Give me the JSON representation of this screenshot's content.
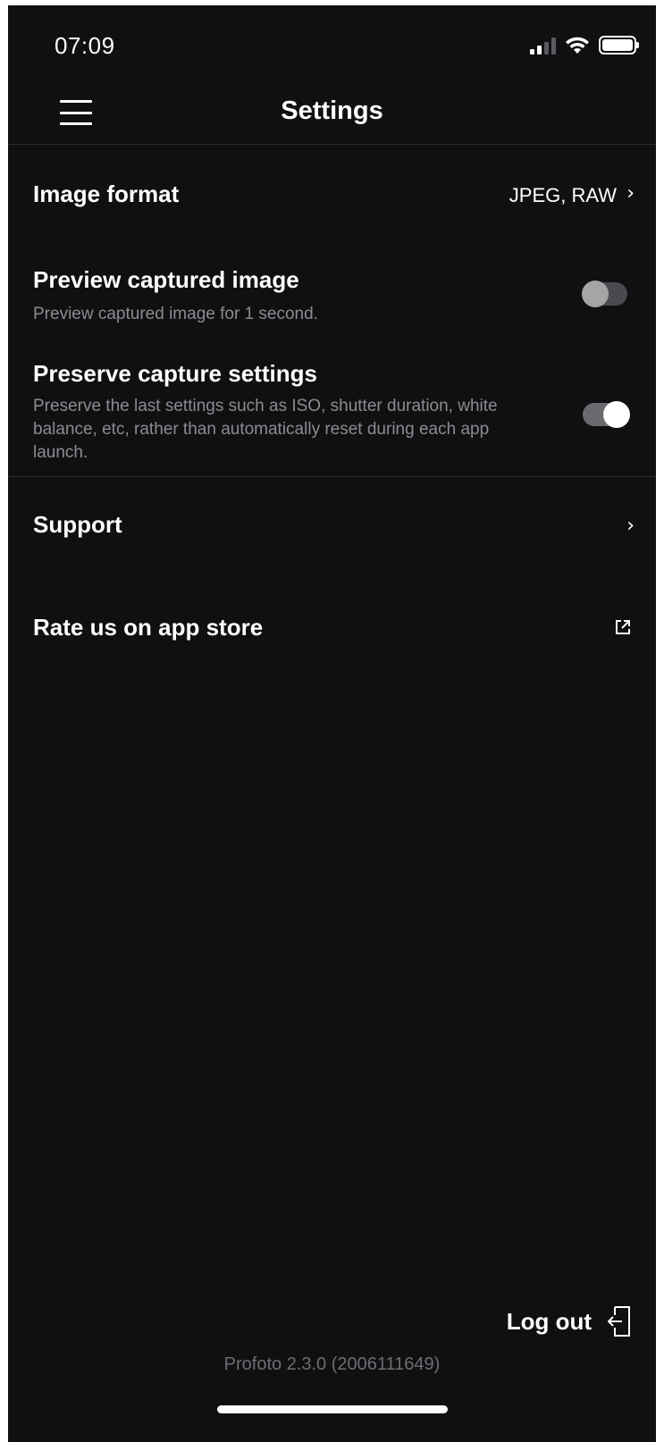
{
  "status_bar": {
    "time": "07:09"
  },
  "header": {
    "title": "Settings"
  },
  "settings": {
    "image_format": {
      "label": "Image format",
      "value": "JPEG, RAW"
    },
    "preview_captured_image": {
      "label": "Preview captured image",
      "description": "Preview captured image for 1 second.",
      "enabled": false
    },
    "preserve_capture_settings": {
      "label": "Preserve capture settings",
      "description": "Preserve the last settings such as ISO, shutter duration, white balance, etc, rather than automatically reset during each app launch.",
      "enabled": true
    },
    "support": {
      "label": "Support"
    },
    "rate_us": {
      "label": "Rate us on app store"
    }
  },
  "footer": {
    "logout_label": "Log out",
    "version": "Profoto 2.3.0 (2006111649)"
  }
}
